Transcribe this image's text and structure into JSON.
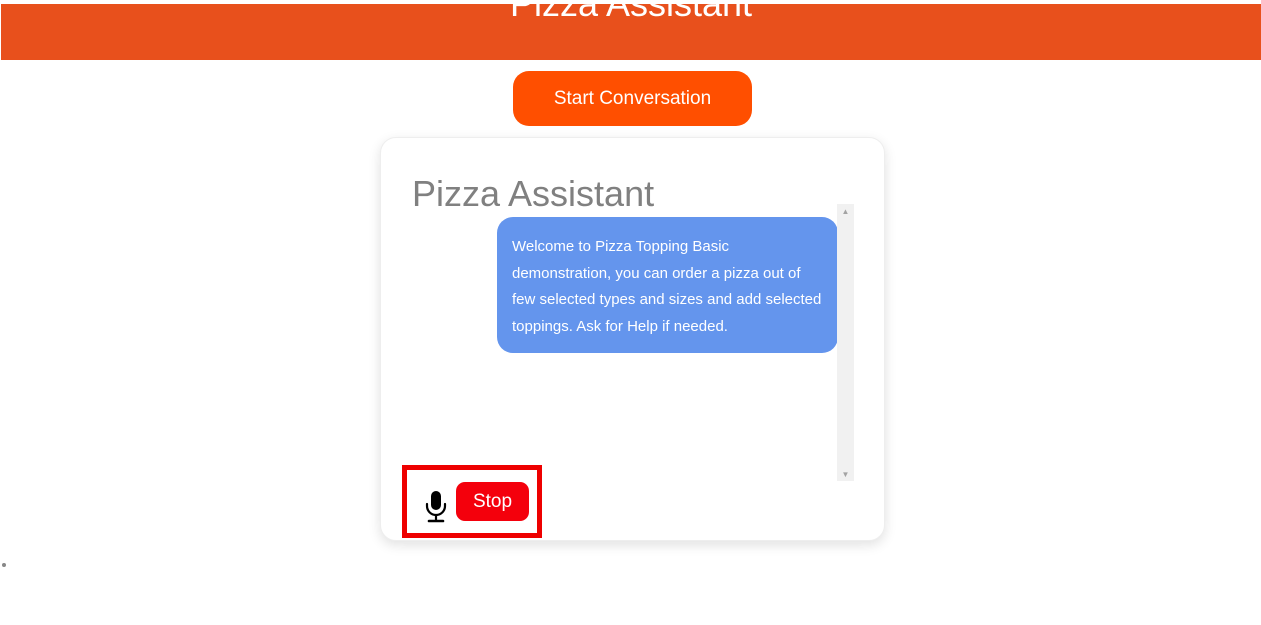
{
  "header": {
    "title": "Pizza Assistant"
  },
  "start_button": {
    "label": "Start Conversation"
  },
  "chat": {
    "title": "Pizza Assistant",
    "messages": [
      {
        "role": "assistant",
        "text": "Welcome to Pizza Topping Basic demonstration, you can order a pizza out of few selected types and sizes and add selected toppings. Ask for Help if needed."
      }
    ]
  },
  "controls": {
    "mic_icon": "microphone-icon",
    "stop_label": "Stop"
  },
  "colors": {
    "banner": "#e8501c",
    "start_button": "#ff4f00",
    "bubble": "#6495ed",
    "stop_button": "#f4000c",
    "highlight_border": "#ee0000"
  }
}
